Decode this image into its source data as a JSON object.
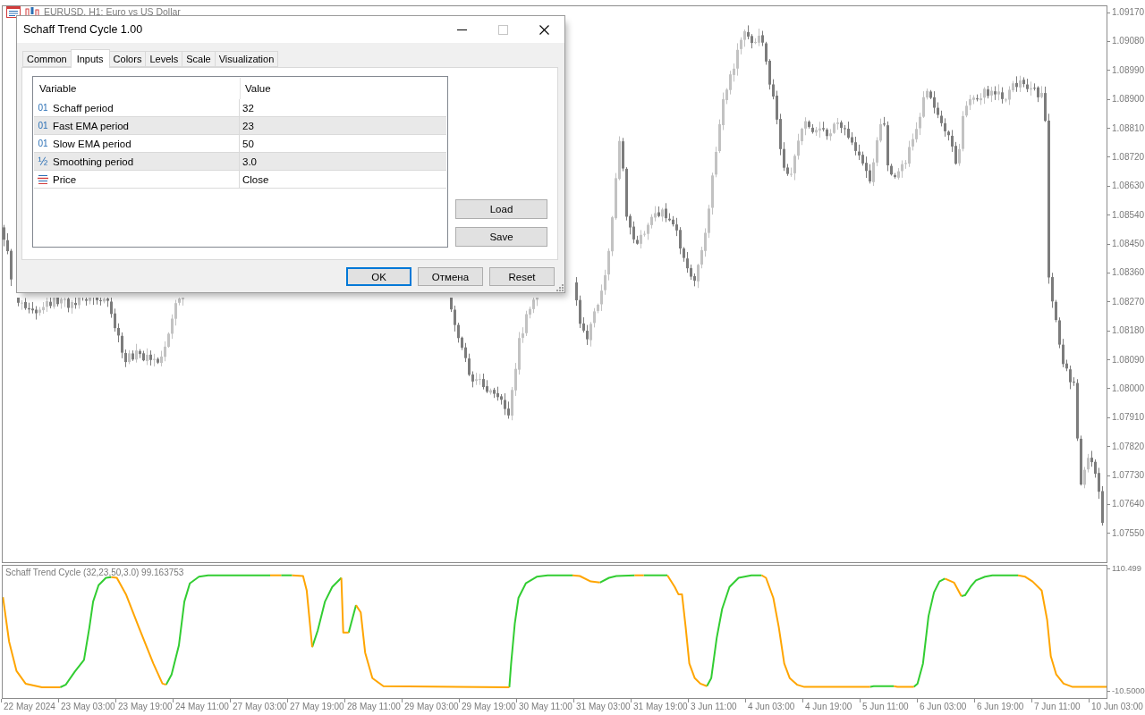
{
  "chart": {
    "title": "EURUSD, H1: Euro vs US Dollar",
    "price_axis": [
      "1.09170",
      "1.09080",
      "1.08990",
      "1.08900",
      "1.08810",
      "1.08720",
      "1.08630",
      "1.08540",
      "1.08450",
      "1.08360",
      "1.08270",
      "1.08180",
      "1.08090",
      "1.08000",
      "1.07910",
      "1.07820",
      "1.07730",
      "1.07640",
      "1.07550"
    ]
  },
  "indicator": {
    "label": "Schaff Trend Cycle (32,23,50,3.0) 99.163753",
    "axis": [
      "110.499",
      "-10.5000"
    ]
  },
  "time_axis": [
    "22 May 2024",
    "23 May 03:00",
    "23 May 19:00",
    "24 May 11:00",
    "27 May 03:00",
    "27 May 19:00",
    "28 May 11:00",
    "29 May 03:00",
    "29 May 19:00",
    "30 May 11:00",
    "31 May 03:00",
    "31 May 19:00",
    "3 Jun 11:00",
    "4 Jun 03:00",
    "4 Jun 19:00",
    "5 Jun 11:00",
    "6 Jun 03:00",
    "6 Jun 19:00",
    "7 Jun 11:00",
    "10 Jun 03:00"
  ],
  "dialog": {
    "title": "Schaff Trend Cycle 1.00",
    "window_buttons": [
      {
        "kind": "minimize",
        "disabled": false
      },
      {
        "kind": "maximize",
        "disabled": true
      },
      {
        "kind": "close",
        "disabled": false
      }
    ],
    "tabs": [
      {
        "label": "Common",
        "selected": false
      },
      {
        "label": "Inputs",
        "selected": true
      },
      {
        "label": "Colors",
        "selected": false
      },
      {
        "label": "Levels",
        "selected": false
      },
      {
        "label": "Scale",
        "selected": false
      },
      {
        "label": "Visualization",
        "selected": false
      }
    ],
    "table": {
      "columns": [
        "Variable",
        "Value"
      ],
      "rows": [
        {
          "kind": "int",
          "type_mark": "01",
          "variable": "Schaff period",
          "value": "32"
        },
        {
          "kind": "int",
          "type_mark": "01",
          "variable": "Fast EMA period",
          "value": "23"
        },
        {
          "kind": "int",
          "type_mark": "01",
          "variable": "Slow EMA period",
          "value": "50"
        },
        {
          "kind": "double",
          "type_mark": "½",
          "variable": "Smoothing period",
          "value": "3.0"
        },
        {
          "kind": "enum",
          "variable": "Price",
          "value": "Close"
        }
      ]
    },
    "side_buttons": [
      "Load",
      "Save"
    ],
    "buttons": [
      {
        "label": "OK",
        "default": true
      },
      {
        "label": "Отмена",
        "default": false
      },
      {
        "label": "Reset",
        "default": false
      }
    ]
  }
}
